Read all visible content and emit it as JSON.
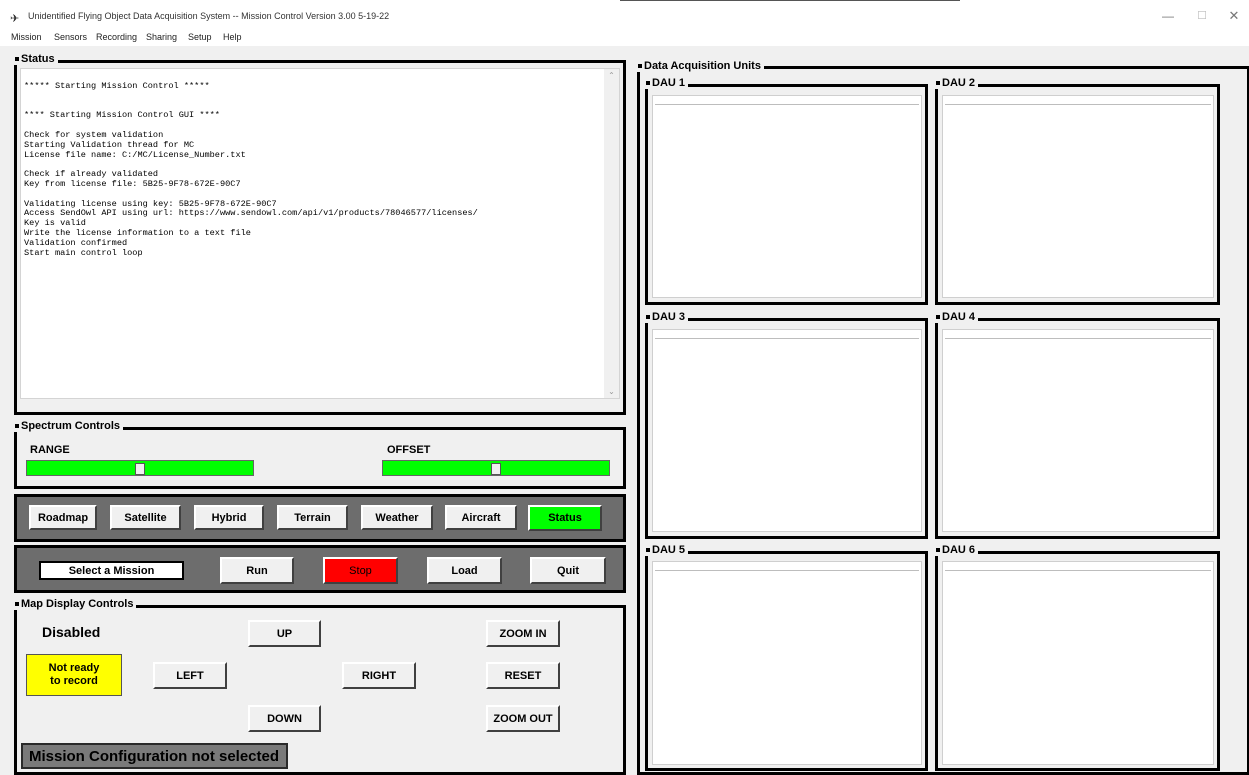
{
  "window": {
    "title": "Unidentified Flying Object Data Acquisition System -- Mission Control   Version 3.00  5-19-22",
    "icon": "ufo-icon",
    "controls": {
      "minimize": "—",
      "maximize": "☐",
      "close": "✕"
    }
  },
  "menu": [
    "Mission",
    "Sensors",
    "Recording",
    "Sharing",
    "Setup",
    "Help"
  ],
  "status": {
    "title": "Status",
    "lines": [
      "***** Starting Mission Control *****",
      "",
      "",
      "**** Starting Mission Control GUI ****",
      "",
      "Check for system validation",
      "Starting Validation thread for MC",
      "License file name: C:/MC/License_Number.txt",
      "",
      "Check if already validated",
      "Key from license file: 5B25-9F78-672E-90C7",
      "",
      "Validating license using key: 5B25-9F78-672E-90C7",
      "Access SendOwl API using url: https://www.sendowl.com/api/v1/products/78046577/licenses/",
      "Key is valid",
      "Write the license information to a text file",
      "Validation confirmed",
      "Start main control loop"
    ]
  },
  "spectrum": {
    "title": "Spectrum Controls",
    "range_label": "RANGE",
    "offset_label": "OFFSET",
    "range_value": 0.5,
    "offset_value": 0.5
  },
  "map_types": [
    "Roadmap",
    "Satellite",
    "Hybrid",
    "Terrain",
    "Weather",
    "Aircraft",
    "Status"
  ],
  "mission": {
    "select_label": "Select a Mission",
    "run": "Run",
    "stop": "Stop",
    "load": "Load",
    "quit": "Quit"
  },
  "map_controls": {
    "title": "Map Display Controls",
    "disabled": "Disabled",
    "record_status_line1": "Not ready",
    "record_status_line2": "to record",
    "up": "UP",
    "down": "DOWN",
    "left": "LEFT",
    "right": "RIGHT",
    "zoom_in": "ZOOM IN",
    "reset": "RESET",
    "zoom_out": "ZOOM OUT",
    "config_status": "Mission Configuration not selected"
  },
  "dau": {
    "title": "Data Acquisition Units",
    "units": [
      "DAU 1",
      "DAU 2",
      "DAU 3",
      "DAU 4",
      "DAU 5",
      "DAU 6"
    ]
  },
  "colors": {
    "slider_green": "#00ff00",
    "status_green": "#00ff00",
    "stop_red": "#ff0000",
    "record_yellow": "#ffff00",
    "panel_gray": "#6d6d6d"
  }
}
